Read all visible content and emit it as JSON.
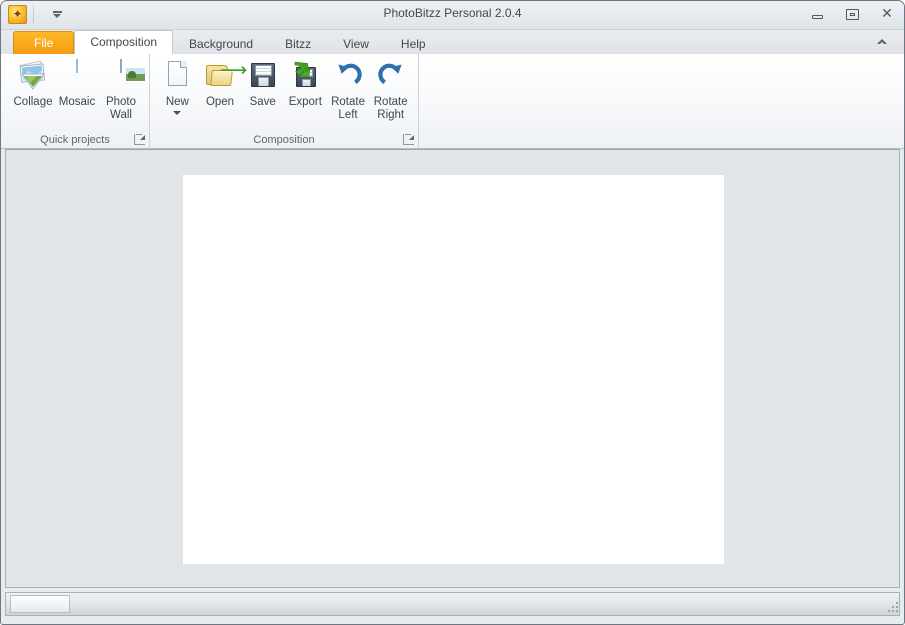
{
  "window": {
    "title": "PhotoBitzz Personal 2.0.4",
    "app_icon": "butterfly-app-icon",
    "quick_access_dropdown": "customize-quick-access-toolbar",
    "controls": {
      "minimize": "minimize-icon",
      "maximize": "maximize-icon",
      "close": "close-icon"
    }
  },
  "ribbon": {
    "collapse_label": "chevron-up-icon",
    "tabs": [
      {
        "label": "File",
        "active": false,
        "style": "file"
      },
      {
        "label": "Composition",
        "active": true,
        "style": "normal"
      },
      {
        "label": "Background",
        "active": false,
        "style": "normal"
      },
      {
        "label": "Bitzz",
        "active": false,
        "style": "normal"
      },
      {
        "label": "View",
        "active": false,
        "style": "normal"
      },
      {
        "label": "Help",
        "active": false,
        "style": "normal"
      }
    ],
    "groups": [
      {
        "title": "Quick projects",
        "dialog_launcher": "dialog-launcher-icon",
        "items": [
          {
            "label": "Collage",
            "icon": "collage-icon",
            "has_dropdown": false
          },
          {
            "label": "Mosaic",
            "icon": "mosaic-icon",
            "has_dropdown": false
          },
          {
            "label": "Photo Wall",
            "icon": "photo-wall-icon",
            "has_dropdown": false
          }
        ]
      },
      {
        "title": "Composition",
        "dialog_launcher": "dialog-launcher-icon",
        "items": [
          {
            "label": "New",
            "icon": "new-document-icon",
            "has_dropdown": true
          },
          {
            "label": "Open",
            "icon": "open-folder-icon",
            "has_dropdown": false
          },
          {
            "label": "Save",
            "icon": "save-floppy-icon",
            "has_dropdown": false
          },
          {
            "label": "Export",
            "icon": "export-icon",
            "has_dropdown": false
          },
          {
            "label": "Rotate Left",
            "icon": "rotate-left-icon",
            "has_dropdown": false
          },
          {
            "label": "Rotate Right",
            "icon": "rotate-right-icon",
            "has_dropdown": false
          }
        ]
      }
    ]
  },
  "workspace": {
    "canvas_label": "composition-canvas",
    "canvas_color": "#ffffff",
    "background_color": "#e2e5e8"
  },
  "statusbar": {
    "panel_text": "",
    "resize_grip": "resize-grip-icon"
  },
  "colors": {
    "accent_orange": "#f7a618",
    "chrome": "#e8ebee",
    "ribbon_border": "#b7bec5",
    "icon_blue": "#2f6fad",
    "icon_green": "#3f9a22"
  }
}
